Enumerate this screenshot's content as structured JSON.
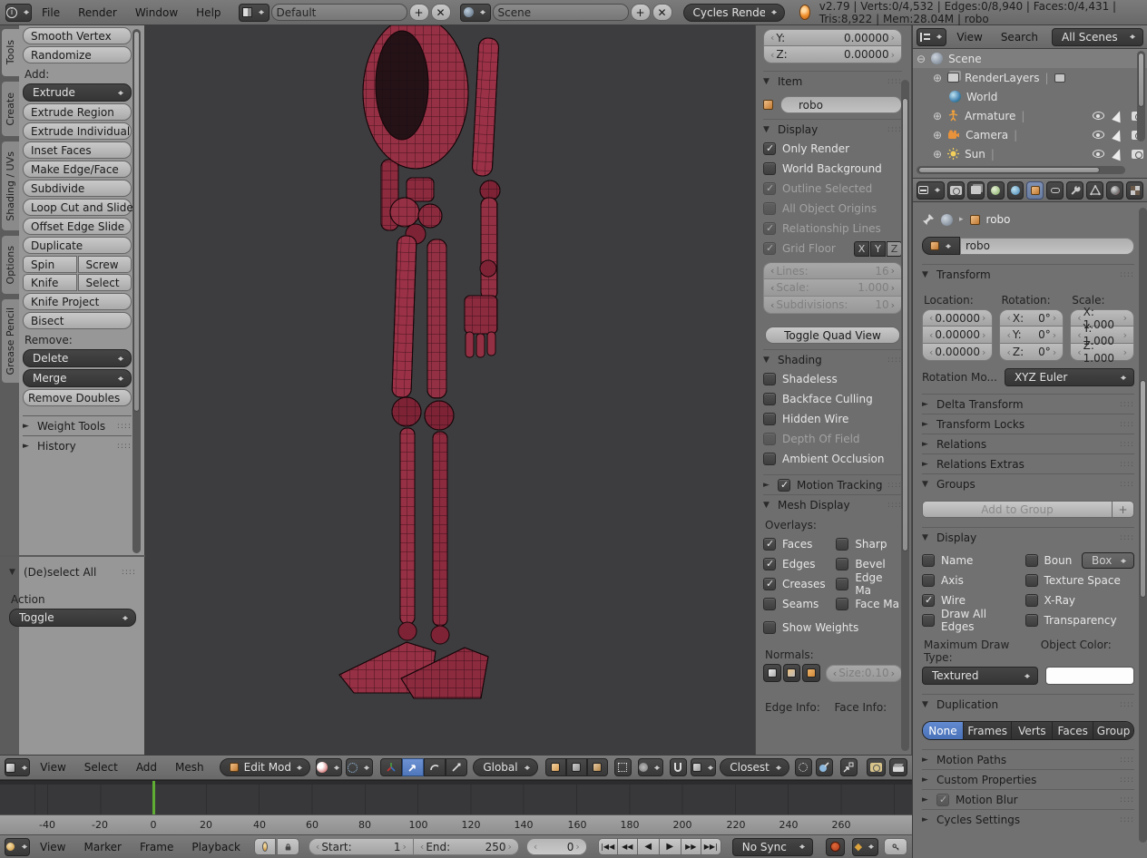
{
  "window": {
    "menus": {
      "file": "File",
      "render": "Render",
      "window": "Window",
      "help": "Help"
    },
    "layout": "Default",
    "scene": "Scene",
    "engine": "Cycles Render",
    "stats": "v2.79 | Verts:0/4,532 | Edges:0/8,940 | Faces:0/4,431 | Tris:8,922 | Mem:28.04M | robo"
  },
  "tool_shelf": {
    "tabs": {
      "tools": "Tools",
      "create": "Create",
      "shading_uvs": "Shading / UVs",
      "options": "Options",
      "grease_pencil": "Grease Pencil"
    },
    "smooth_vertex": "Smooth Vertex",
    "randomize": "Randomize",
    "add_label": "Add:",
    "extrude": "Extrude",
    "extrude_region": "Extrude Region",
    "extrude_individual": "Extrude Individual",
    "inset_faces": "Inset Faces",
    "make_edge_face": "Make Edge/Face",
    "subdivide": "Subdivide",
    "loop_cut_slide": "Loop Cut and Slide",
    "offset_edge_slide": "Offset Edge Slide",
    "duplicate": "Duplicate",
    "spin": "Spin",
    "screw": "Screw",
    "knife": "Knife",
    "select": "Select",
    "knife_project": "Knife Project",
    "bisect": "Bisect",
    "remove_label": "Remove:",
    "delete": "Delete",
    "merge": "Merge",
    "remove_doubles": "Remove Doubles",
    "weight_tools": "Weight Tools",
    "history": "History",
    "operator": {
      "title": "(De)select All",
      "action_label": "Action",
      "action_value": "Toggle"
    }
  },
  "n_panel": {
    "y_label": "Y:",
    "y_value": "0.00000",
    "z_label": "Z:",
    "z_value": "0.00000",
    "item_title": "Item",
    "item_name": "robo",
    "display_title": "Display",
    "only_render": "Only Render",
    "world_background": "World Background",
    "outline_selected": "Outline Selected",
    "all_object_origins": "All Object Origins",
    "relationship_lines": "Relationship Lines",
    "grid_floor": "Grid Floor",
    "axis_x": "X",
    "axis_y": "Y",
    "axis_z": "Z",
    "lines_label": "Lines:",
    "lines_value": "16",
    "scale_label": "Scale:",
    "scale_value": "1.000",
    "subdiv_label": "Subdivisions:",
    "subdiv_value": "10",
    "toggle_quad_view": "Toggle Quad View",
    "shading_title": "Shading",
    "shadeless": "Shadeless",
    "backface_culling": "Backface Culling",
    "hidden_wire": "Hidden Wire",
    "depth_of_field": "Depth Of Field",
    "ambient_occlusion": "Ambient Occlusion",
    "motion_tracking": "Motion Tracking",
    "mesh_display_title": "Mesh Display",
    "overlays_label": "Overlays:",
    "faces": "Faces",
    "sharp": "Sharp",
    "edges": "Edges",
    "bevel": "Bevel",
    "creases": "Creases",
    "edge_ma": "Edge Ma",
    "seams": "Seams",
    "face_ma": "Face Ma",
    "show_weights": "Show Weights",
    "normals_label": "Normals:",
    "size_label": "Size:",
    "size_value": "0.10",
    "edge_info_label": "Edge Info:",
    "face_info_label": "Face Info:"
  },
  "outliner": {
    "view": "View",
    "search": "Search",
    "filter": "All Scenes",
    "scene": "Scene",
    "render_layers": "RenderLayers",
    "world": "World",
    "armature": "Armature",
    "camera": "Camera",
    "sun": "Sun"
  },
  "properties": {
    "breadcrumb": "robo",
    "name": "robo",
    "transform_title": "Transform",
    "location_label": "Location:",
    "rotation_label": "Rotation:",
    "scale_label": "Scale:",
    "loc_0": "0.00000",
    "loc_1": "0.00000",
    "loc_2": "0.00000",
    "rx_label": "X:",
    "ry_label": "Y:",
    "rz_label": "Z:",
    "rx": "0°",
    "ry": "0°",
    "rz": "0°",
    "sx": "X: 1.000",
    "sy": "Y: 1.000",
    "sz": "Z: 1.000",
    "rotmode_label": "Rotation Mo...",
    "rotmode_value": "XYZ Euler",
    "delta_transform": "Delta Transform",
    "transform_locks": "Transform Locks",
    "relations": "Relations",
    "relations_extras": "Relations Extras",
    "groups_title": "Groups",
    "add_to_group": "Add to Group",
    "display_title": "Display",
    "name_chk": "Name",
    "boun": "Boun",
    "box": "Box",
    "axis": "Axis",
    "texture_space": "Texture Space",
    "wire": "Wire",
    "xray": "X-Ray",
    "draw_all_edges": "Draw All Edges",
    "transparency": "Transparency",
    "max_draw_label": "Maximum Draw Type:",
    "max_draw_value": "Textured",
    "object_color_label": "Object Color:",
    "duplication_title": "Duplication",
    "dup_none": "None",
    "dup_frames": "Frames",
    "dup_verts": "Verts",
    "dup_faces": "Faces",
    "dup_group": "Group",
    "motion_paths": "Motion Paths",
    "custom_properties": "Custom Properties",
    "motion_blur": "Motion Blur",
    "cycles_settings": "Cycles Settings"
  },
  "view3d_header": {
    "view": "View",
    "select": "Select",
    "add": "Add",
    "mesh": "Mesh",
    "mode": "Edit Mode",
    "orientation": "Global",
    "snap_target": "Closest"
  },
  "timeline": {
    "ruler": [
      "-40",
      "-20",
      "0",
      "20",
      "40",
      "60",
      "80",
      "100",
      "120",
      "140",
      "160",
      "180",
      "200",
      "220",
      "240",
      "260"
    ],
    "view": "View",
    "marker": "Marker",
    "frame": "Frame",
    "playback": "Playback",
    "start_label": "Start:",
    "start_value": "1",
    "end_label": "End:",
    "end_value": "250",
    "current_frame": "0",
    "sync": "No Sync"
  },
  "colors": {
    "accent_blue": "#5a82c8",
    "playhead_green": "#5fae33",
    "robot_red": "#9b3147"
  }
}
